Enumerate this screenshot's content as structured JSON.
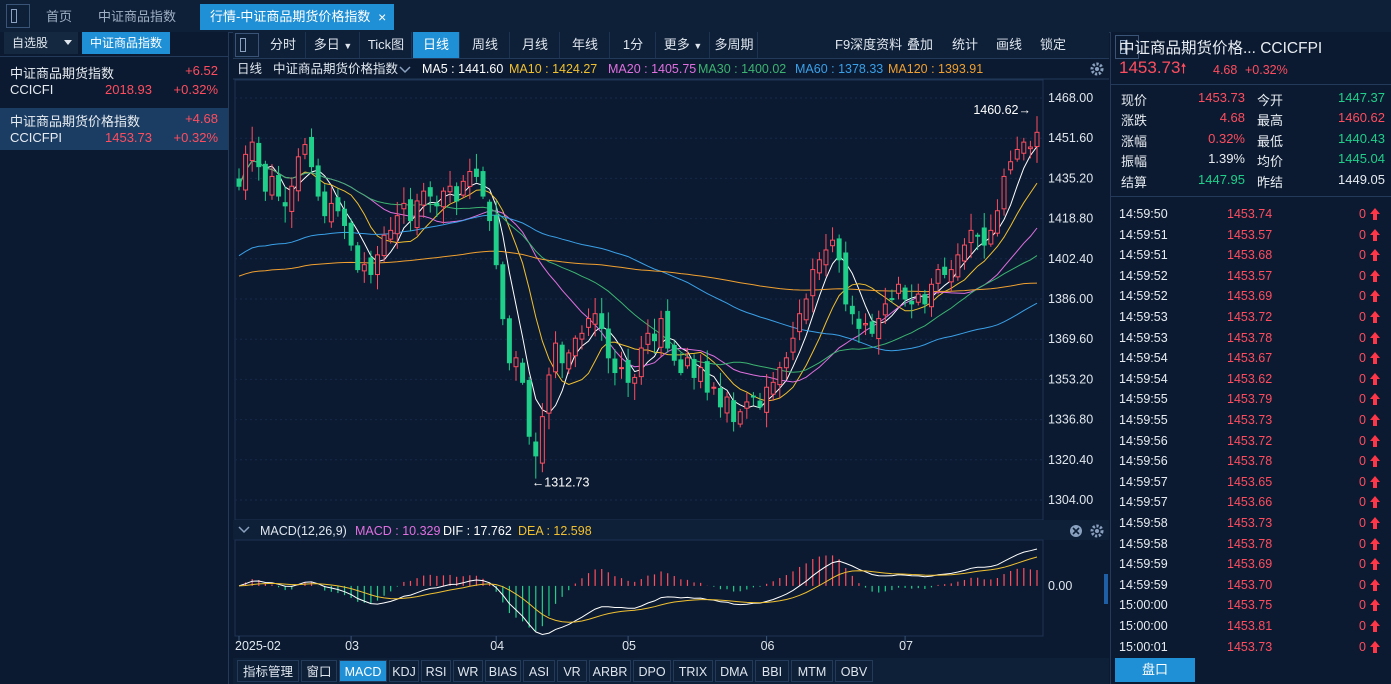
{
  "tabs": [
    {
      "label": "首页",
      "active": false
    },
    {
      "label": "中证商品指数",
      "active": false
    },
    {
      "label": "行情-中证商品期货价格指数",
      "active": true,
      "close": "×"
    }
  ],
  "sidebar": {
    "tab_watch": "自选股",
    "tab_index": "中证商品指数",
    "items": [
      {
        "name": "中证商品期货指数",
        "change": "+6.52",
        "code": "CCICFI",
        "price": "2018.93",
        "pct": "+0.32%"
      },
      {
        "name": "中证商品期货价格指数",
        "change": "+4.68",
        "code": "CCICFPI",
        "price": "1453.73",
        "pct": "+0.32%"
      }
    ]
  },
  "toolbar": {
    "periods": [
      "分时",
      "多日",
      "Tick图",
      "日线",
      "周线",
      "月线",
      "年线",
      "1分",
      "更多",
      "多周期"
    ],
    "active": "日线",
    "right": [
      "F9深度资料",
      "叠加",
      "统计",
      "画线",
      "锁定"
    ]
  },
  "kline_header": {
    "period": "日线",
    "name": "中证商品期货价格指数",
    "ma": [
      {
        "label": "MA5 : 1441.60",
        "color": "#ffffff"
      },
      {
        "label": "MA10 : 1424.27",
        "color": "#f0c030"
      },
      {
        "label": "MA20 : 1405.75",
        "color": "#e070e0"
      },
      {
        "label": "MA30 : 1400.02",
        "color": "#3cb371"
      },
      {
        "label": "MA60 : 1378.33",
        "color": "#3aa0e8"
      },
      {
        "label": "MA120 : 1393.91",
        "color": "#f0a030"
      }
    ]
  },
  "macd_header": {
    "title": "MACD(12,26,9)",
    "macd": "MACD : 10.329",
    "dif": "DIF : 17.762",
    "dea": "DEA : 12.598"
  },
  "indicators": {
    "manage": "指标管理",
    "window": "窗口",
    "items": [
      "MACD",
      "KDJ",
      "RSI",
      "WR",
      "BIAS",
      "ASI",
      "VR",
      "ARBR",
      "DPO",
      "TRIX",
      "DMA",
      "BBI",
      "MTM",
      "OBV"
    ],
    "active": "MACD"
  },
  "colors": {
    "up": "#ff4d5f",
    "down": "#1fcf8a",
    "accent": "#1f8fd6"
  },
  "chart_data": {
    "type": "candlestick",
    "ylim": [
      1304.0,
      1468.0
    ],
    "y_ticks": [
      "1468.00",
      "1451.60",
      "1435.20",
      "1418.80",
      "1402.40",
      "1386.00",
      "1369.60",
      "1353.20",
      "1336.80",
      "1320.40",
      "1304.00"
    ],
    "x_ticks": [
      {
        "label": "2025-02",
        "index": 0
      },
      {
        "label": "03",
        "index": 17
      },
      {
        "label": "04",
        "index": 39
      },
      {
        "label": "05",
        "index": 59
      },
      {
        "label": "06",
        "index": 80
      },
      {
        "label": "07",
        "index": 101
      }
    ],
    "high_label": "1460.62→",
    "low_label": "←1312.73",
    "high_value": 1460.62,
    "low_value": 1312.73,
    "high_index": 121,
    "low_index": 45,
    "closes": [
      1432,
      1445,
      1450,
      1440,
      1430,
      1436,
      1428,
      1424,
      1432,
      1444,
      1449,
      1440,
      1428,
      1420,
      1425,
      1422,
      1416,
      1408,
      1398,
      1400,
      1396,
      1404,
      1412,
      1414,
      1420,
      1425,
      1418,
      1426,
      1430,
      1428,
      1424,
      1430,
      1432,
      1426,
      1434,
      1438,
      1436,
      1428,
      1418,
      1400,
      1378,
      1360,
      1362,
      1352,
      1330,
      1322,
      1338,
      1355,
      1368,
      1360,
      1364,
      1370,
      1372,
      1378,
      1380,
      1374,
      1362,
      1356,
      1358,
      1352,
      1354,
      1366,
      1372,
      1369,
      1378,
      1366,
      1361,
      1356,
      1362,
      1354,
      1358,
      1348,
      1350,
      1342,
      1346,
      1336,
      1340,
      1344,
      1346,
      1342,
      1350,
      1352,
      1358,
      1362,
      1370,
      1380,
      1386,
      1398,
      1402,
      1406,
      1410,
      1402,
      1384,
      1380,
      1374,
      1376,
      1372,
      1378,
      1384,
      1386,
      1392,
      1386,
      1384,
      1388,
      1384,
      1392,
      1398,
      1396,
      1398,
      1404,
      1408,
      1414,
      1412,
      1408,
      1414,
      1422,
      1436,
      1442,
      1447,
      1450,
      1448,
      1454
    ],
    "macd_ylim": [
      -22,
      20
    ],
    "macd_zero_label": "0.00",
    "macd_last": 10.329,
    "dif_last": 17.762,
    "dea_last": 12.598
  },
  "quote": {
    "title": "中证商品期货价格... CCICFPI",
    "price": "1453.73",
    "change": "4.68",
    "pct": "+0.32%",
    "rows": [
      {
        "l1": "现价",
        "v1": "1453.73",
        "c1": "red",
        "l2": "今开",
        "v2": "1447.37",
        "c2": "green"
      },
      {
        "l1": "涨跌",
        "v1": "4.68",
        "c1": "red",
        "l2": "最高",
        "v2": "1460.62",
        "c2": "red"
      },
      {
        "l1": "涨幅",
        "v1": "0.32%",
        "c1": "red",
        "l2": "最低",
        "v2": "1440.43",
        "c2": "green"
      },
      {
        "l1": "振幅",
        "v1": "1.39%",
        "c1": "white",
        "l2": "均价",
        "v2": "1445.04",
        "c2": "green"
      },
      {
        "l1": "结算",
        "v1": "1447.95",
        "c1": "green",
        "l2": "昨结",
        "v2": "1449.05",
        "c2": "white"
      }
    ]
  },
  "ticks": [
    {
      "t": "14:59:50",
      "p": "1453.74",
      "v": "0"
    },
    {
      "t": "14:59:51",
      "p": "1453.57",
      "v": "0"
    },
    {
      "t": "14:59:51",
      "p": "1453.68",
      "v": "0"
    },
    {
      "t": "14:59:52",
      "p": "1453.57",
      "v": "0"
    },
    {
      "t": "14:59:52",
      "p": "1453.69",
      "v": "0"
    },
    {
      "t": "14:59:53",
      "p": "1453.72",
      "v": "0"
    },
    {
      "t": "14:59:53",
      "p": "1453.78",
      "v": "0"
    },
    {
      "t": "14:59:54",
      "p": "1453.67",
      "v": "0"
    },
    {
      "t": "14:59:54",
      "p": "1453.62",
      "v": "0"
    },
    {
      "t": "14:59:55",
      "p": "1453.79",
      "v": "0"
    },
    {
      "t": "14:59:55",
      "p": "1453.73",
      "v": "0"
    },
    {
      "t": "14:59:56",
      "p": "1453.72",
      "v": "0"
    },
    {
      "t": "14:59:56",
      "p": "1453.78",
      "v": "0"
    },
    {
      "t": "14:59:57",
      "p": "1453.65",
      "v": "0"
    },
    {
      "t": "14:59:57",
      "p": "1453.66",
      "v": "0"
    },
    {
      "t": "14:59:58",
      "p": "1453.73",
      "v": "0"
    },
    {
      "t": "14:59:58",
      "p": "1453.78",
      "v": "0"
    },
    {
      "t": "14:59:59",
      "p": "1453.69",
      "v": "0"
    },
    {
      "t": "14:59:59",
      "p": "1453.70",
      "v": "0"
    },
    {
      "t": "15:00:00",
      "p": "1453.75",
      "v": "0"
    },
    {
      "t": "15:00:00",
      "p": "1453.81",
      "v": "0"
    },
    {
      "t": "15:00:01",
      "p": "1453.73",
      "v": "0"
    }
  ],
  "bottom_tab": "盘口"
}
